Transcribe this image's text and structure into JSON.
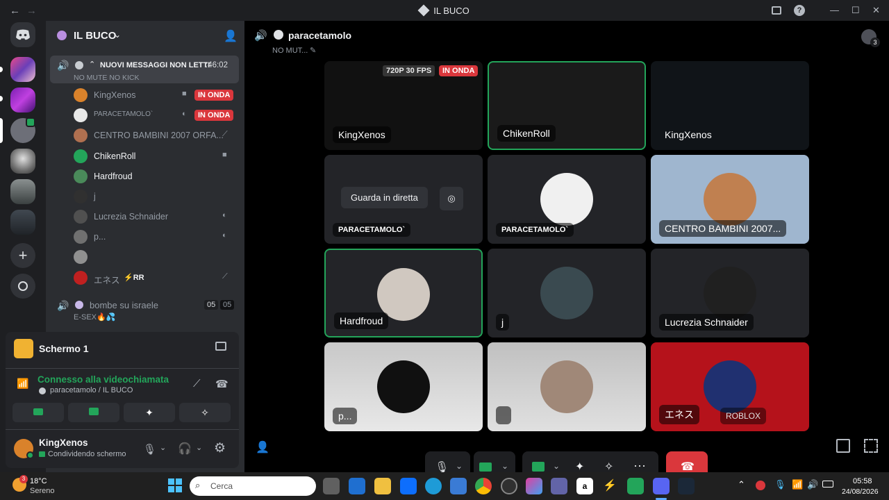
{
  "window": {
    "title": "IL BUCO",
    "back_glyph": "←",
    "fwd_glyph": "→",
    "help_glyph": "?",
    "min_glyph": "—",
    "max_glyph": "☐",
    "close_glyph": "✕"
  },
  "server": {
    "name": "IL BUCO"
  },
  "sidebar": {
    "banner": {
      "label": "NUOVI MESSAGGI NON LETTI",
      "time": ":46:02",
      "subtitle": "NO MUTE NO KICK"
    },
    "members": [
      {
        "name": "KingXenos",
        "live": "IN ONDA",
        "icon": "video-icon"
      },
      {
        "name": "PARACETAMOLO`",
        "live": "IN ONDA",
        "icon": "mic-icon"
      },
      {
        "name": "CENTRO BAMBINI 2007 ORFA...",
        "icon": "mic-muted-icon"
      },
      {
        "name": "ChikenRoll",
        "icon": "video-icon"
      },
      {
        "name": "Hardfroud"
      },
      {
        "name": "j"
      },
      {
        "name": "Lucrezia Schnaider",
        "icon": "deafened-icon"
      },
      {
        "name": "p...",
        "icon": "deafened-icon"
      },
      {
        "name": ""
      },
      {
        "name": "エネス",
        "tag": "⚡RR",
        "icon": "mic-muted-icon"
      }
    ],
    "channel2": {
      "name": "bombe su israele",
      "count_a": "05",
      "count_b": "05",
      "subtitle": "E-SEX🔥💦"
    }
  },
  "panel": {
    "stream_title": "Schermo 1",
    "connection": "Connesso alla videochiamata",
    "location": "paracetamolo / IL BUCO",
    "user": {
      "name": "KingXenos",
      "status": "Condividendo schermo"
    },
    "gear_glyph": "⚙",
    "headset_glyph": "🎧"
  },
  "stage": {
    "channel": "paracetamolo",
    "status": "NO MUT...",
    "tiles": [
      {
        "name": "KingXenos",
        "quality": "720P 30 FPS",
        "live": "IN ONDA"
      },
      {
        "name": "ChikenRoll"
      },
      {
        "name": "KingXenos"
      },
      {
        "name": "PARACETAMOLO`",
        "action": "Guarda in diretta"
      },
      {
        "name": "PARACETAMOLO`"
      },
      {
        "name": "CENTRO BAMBINI 2007..."
      },
      {
        "name": "Hardfroud"
      },
      {
        "name": "j"
      },
      {
        "name": "Lucrezia Schnaider"
      },
      {
        "name": "p..."
      },
      {
        "name": ""
      },
      {
        "name": "エネス",
        "activity": "ROBLOX"
      }
    ],
    "controls": {
      "more": "···",
      "chevron": "⌄"
    }
  },
  "notif_count": "3",
  "taskbar": {
    "weather_temp": "18°C",
    "weather_desc": "Sereno",
    "weather_badge": "3",
    "search_placeholder": "Cerca",
    "time": "05:58",
    "date": "24/08/2026",
    "chevron_up": "⌃",
    "amazon_glyph": "a"
  },
  "colors": {
    "live": "#da373c",
    "green": "#23a55a",
    "sidebar": "#2b2d31",
    "bg": "#1e1f22"
  }
}
